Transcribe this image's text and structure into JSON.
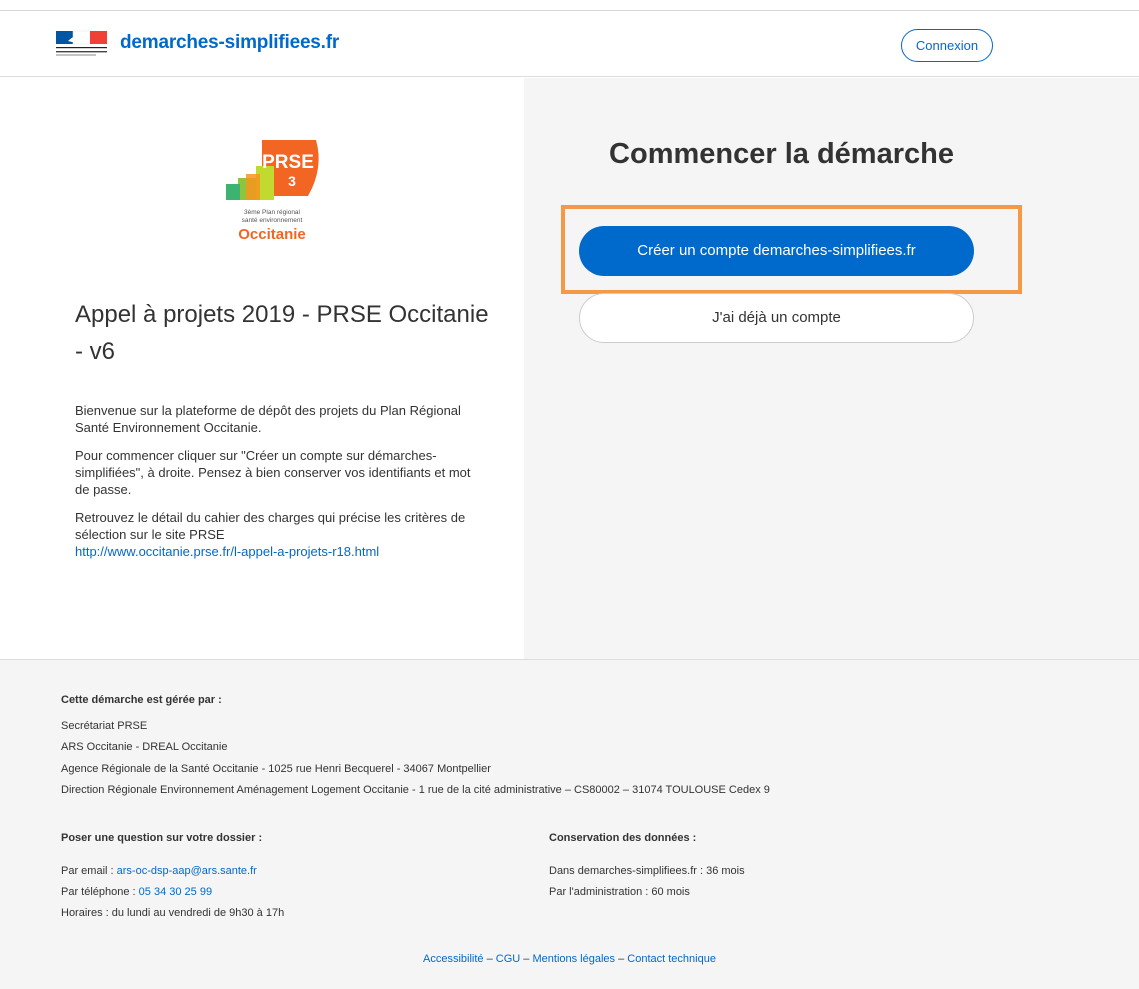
{
  "header": {
    "site_name": "demarches-simplifiees.fr",
    "login_label": "Connexion"
  },
  "logo": {
    "acronym": "PRSE",
    "number": "3",
    "tagline_line1": "3ème Plan régional",
    "tagline_line2": "santé environnement",
    "region": "Occitanie"
  },
  "procedure": {
    "title": "Appel à projets 2019 - PRSE Occitanie - v6",
    "paragraphs": [
      "Bienvenue sur la plateforme de dépôt des projets du Plan Régional Santé Environnement Occitanie.",
      "Pour commencer cliquer sur \"Créer un compte sur démarches-simplifiées\", à droite. Pensez à bien conserver vos identifiants et mot de passe.",
      "Retrouvez le détail du cahier des charges qui précise les critères de sélection sur le site PRSE"
    ],
    "link": "http://www.occitanie.prse.fr/l-appel-a-projets-r18.html"
  },
  "start": {
    "title": "Commencer la démarche",
    "create_account_label": "Créer un compte demarches-simplifiees.fr",
    "existing_account_label": "J'ai déjà un compte"
  },
  "footer": {
    "managed_by_heading": "Cette démarche est gérée par :",
    "managed_lines": [
      "Secrétariat PRSE",
      "ARS Occitanie - DREAL Occitanie",
      "Agence Régionale de la Santé Occitanie - 1025 rue Henri Becquerel - 34067 Montpellier",
      "Direction Régionale Environnement Aménagement Logement Occitanie - 1 rue de la cité administrative – CS80002 – 31074 TOULOUSE Cedex 9"
    ],
    "question_heading": "Poser une question sur votre dossier :",
    "email_prefix": "Par email : ",
    "email": "ars-oc-dsp-aap@ars.sante.fr",
    "phone_prefix": "Par téléphone : ",
    "phone": "05 34 30 25 99",
    "hours": "Horaires : du lundi au vendredi de 9h30 à 17h",
    "retention_heading": "Conservation des données :",
    "retention_lines": [
      "Dans demarches-simplifiees.fr : 36 mois",
      "Par l'administration : 60 mois"
    ],
    "links": {
      "accessibility": "Accessibilité",
      "cgu": "CGU",
      "legal": "Mentions légales",
      "contact": "Contact technique",
      "separator": " – "
    }
  }
}
